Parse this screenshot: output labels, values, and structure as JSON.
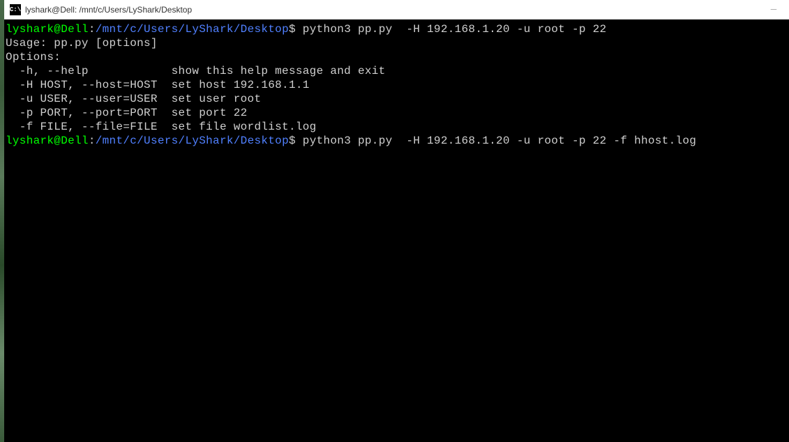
{
  "titlebar": {
    "icon_label": "C:\\",
    "title": "lyshark@Dell: /mnt/c/Users/LyShark/Desktop",
    "minimize": "—"
  },
  "terminal": {
    "prompt1": {
      "user": "lyshark@Dell",
      "sep": ":",
      "path": "/mnt/c/Users/LyShark/Desktop",
      "dollar": "$",
      "command": " python3 pp.py  -H 192.168.1.20 -u root -p 22"
    },
    "output": {
      "usage": "Usage: pp.py [options]",
      "blank": "",
      "options_header": "Options:",
      "opt_h": "  -h, --help            show this help message and exit",
      "opt_host": "  -H HOST, --host=HOST  set host 192.168.1.1",
      "opt_user": "  -u USER, --user=USER  set user root",
      "opt_port": "  -p PORT, --port=PORT  set port 22",
      "opt_file": "  -f FILE, --file=FILE  set file wordlist.log"
    },
    "prompt2": {
      "user": "lyshark@Dell",
      "sep": ":",
      "path": "/mnt/c/Users/LyShark/Desktop",
      "dollar": "$",
      "command": " python3 pp.py  -H 192.168.1.20 -u root -p 22 -f hhost.log"
    }
  }
}
